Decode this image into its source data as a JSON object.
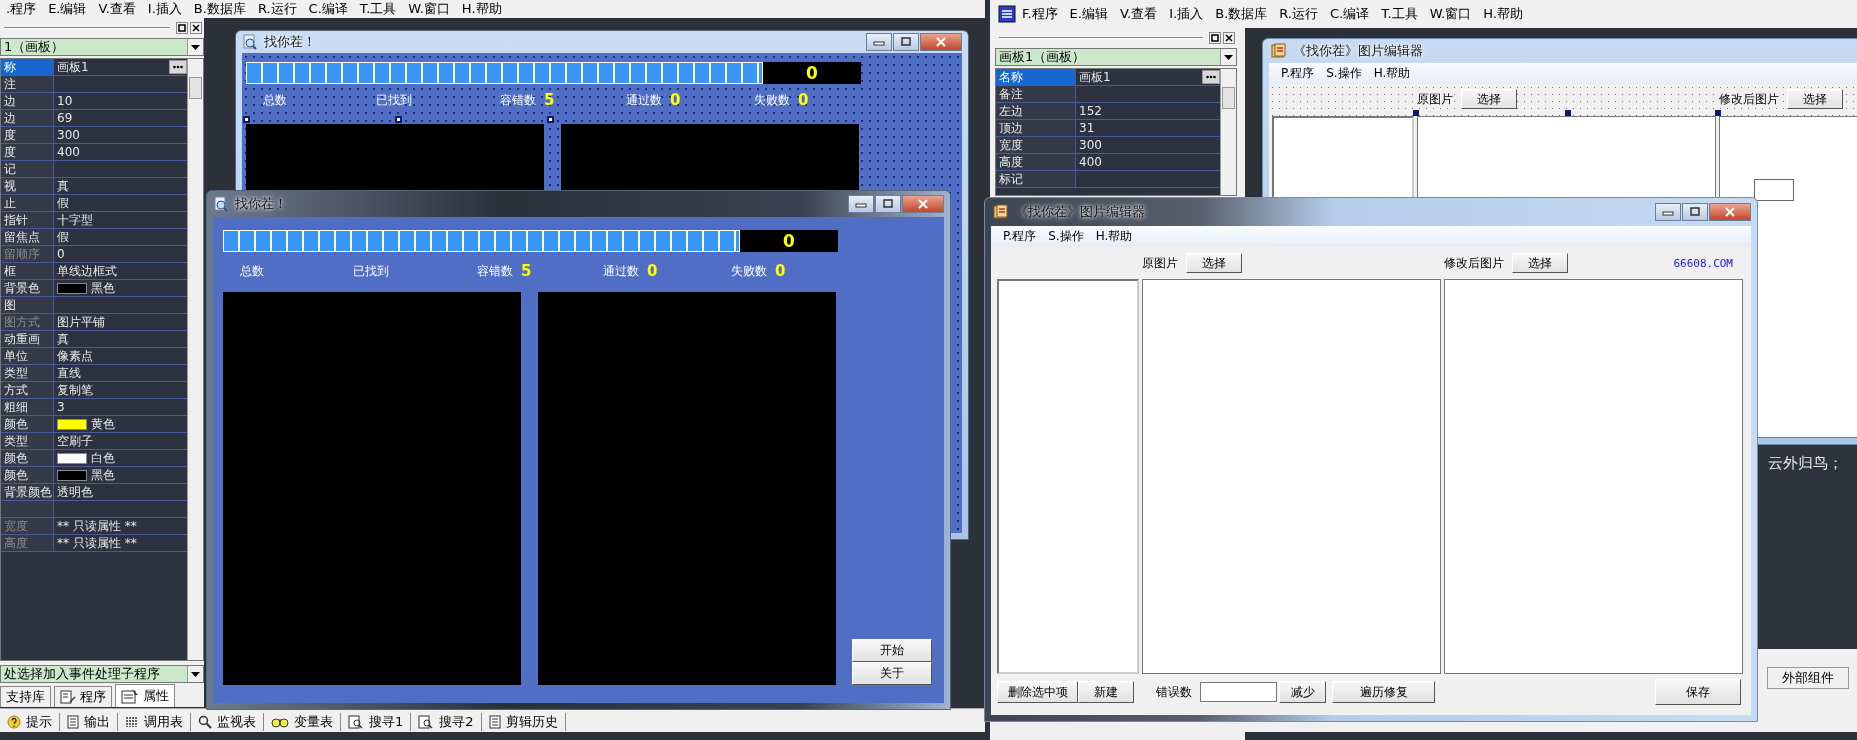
{
  "left_ide": {
    "menu": [
      ".程序",
      "E.编辑",
      "V.查看",
      "I.插入",
      "B.数据库",
      "R.运行",
      "C.编译",
      "T.工具",
      "W.窗口",
      "H.帮助"
    ],
    "property_panel": {
      "object_combo": "1（画板）",
      "rows": [
        {
          "name": "称",
          "value": "画板1",
          "kind": "text",
          "selected": true,
          "disabled": false
        },
        {
          "name": "注",
          "kind": "text",
          "selected": false,
          "disabled": false
        },
        {
          "name": "边",
          "value": "10",
          "kind": "text",
          "selected": false,
          "disabled": false
        },
        {
          "name": "边",
          "value": "69",
          "kind": "text",
          "selected": false,
          "disabled": false
        },
        {
          "name": "度",
          "value": "300",
          "kind": "text",
          "selected": false,
          "disabled": false
        },
        {
          "name": "度",
          "value": "400",
          "kind": "text",
          "selected": false,
          "disabled": false
        },
        {
          "name": "记",
          "kind": "text",
          "selected": false,
          "disabled": false
        },
        {
          "name": "视",
          "value": "真",
          "kind": "text",
          "selected": false,
          "disabled": false
        },
        {
          "name": "止",
          "value": "假",
          "kind": "text",
          "selected": false,
          "disabled": false
        },
        {
          "name": "指针",
          "value": "十字型",
          "kind": "text",
          "selected": false,
          "disabled": false
        },
        {
          "name": "留焦点",
          "value": "假",
          "kind": "text",
          "selected": false,
          "disabled": false
        },
        {
          "name": "留顺序",
          "value": "0",
          "kind": "text",
          "selected": false,
          "disabled": true
        },
        {
          "name": "框",
          "value": "单线边框式",
          "kind": "text",
          "selected": false,
          "disabled": false
        },
        {
          "name": "背景色",
          "value": "黑色",
          "kind": "color",
          "color": "#000000",
          "selected": false,
          "disabled": false
        },
        {
          "name": "图",
          "kind": "text",
          "selected": false,
          "disabled": false
        },
        {
          "name": "图方式",
          "value": "图片平铺",
          "kind": "text",
          "selected": false,
          "disabled": true
        },
        {
          "name": "动重画",
          "value": "真",
          "kind": "text",
          "selected": false,
          "disabled": false
        },
        {
          "name": "单位",
          "value": "像素点",
          "kind": "text",
          "selected": false,
          "disabled": false
        },
        {
          "name": "类型",
          "value": "直线",
          "kind": "text",
          "selected": false,
          "disabled": false
        },
        {
          "name": "方式",
          "value": "复制笔",
          "kind": "text",
          "selected": false,
          "disabled": false
        },
        {
          "name": "粗细",
          "value": "3",
          "kind": "text",
          "selected": false,
          "disabled": false
        },
        {
          "name": "颜色",
          "value": "黄色",
          "kind": "color",
          "color": "#ffff00",
          "selected": false,
          "disabled": false
        },
        {
          "name": "类型",
          "value": "空刷子",
          "kind": "text",
          "selected": false,
          "disabled": false
        },
        {
          "name": "颜色",
          "value": "白色",
          "kind": "color",
          "color": "#ffffff",
          "selected": false,
          "disabled": false
        },
        {
          "name": "颜色",
          "value": "黑色",
          "kind": "color",
          "color": "#000000",
          "selected": false,
          "disabled": false
        },
        {
          "name": "背景颜色",
          "value": "透明色",
          "kind": "text",
          "selected": false,
          "disabled": false
        },
        {
          "kind": "text",
          "selected": false
        },
        {
          "name": "宽度",
          "value": "** 只读属性 **",
          "kind": "text",
          "selected": false,
          "disabled": true
        },
        {
          "name": "高度",
          "value": "** 只读属性 **",
          "kind": "text",
          "selected": false,
          "disabled": true
        }
      ],
      "event_combo": "处选择加入事件处理子程序",
      "tabs": [
        {
          "label": "支持库",
          "selected": false
        },
        {
          "label": "程序",
          "selected": false
        },
        {
          "label": "属性",
          "selected": true
        }
      ]
    },
    "bottom_tabs": [
      "提示",
      "输出",
      "调用表",
      "监视表",
      "变量表",
      "搜寻1",
      "搜寻2",
      "剪辑历史"
    ]
  },
  "designer_window": {
    "title": "找你茬！",
    "counter": "0",
    "timer": {
      "level": 1
    },
    "stats": [
      {
        "label": "总数"
      },
      {
        "label": "已找到"
      },
      {
        "label": "容错数",
        "value": "5"
      },
      {
        "label": "通过数",
        "value": "0"
      },
      {
        "label": "失败数",
        "value": "0"
      }
    ]
  },
  "game_window": {
    "title": "找你茬！",
    "counter": "0",
    "timer": {
      "level": 1
    },
    "stats": [
      {
        "label": "总数"
      },
      {
        "label": "已找到"
      },
      {
        "label": "容错数",
        "value": "5"
      },
      {
        "label": "通过数",
        "value": "0"
      },
      {
        "label": "失败数",
        "value": "0"
      }
    ],
    "buttons": [
      "开始",
      "关于"
    ]
  },
  "right_ide": {
    "menu": [
      "F.程序",
      "E.编辑",
      "V.查看",
      "I.插入",
      "B.数据库",
      "R.运行",
      "C.编译",
      "T.工具",
      "W.窗口",
      "H.帮助"
    ],
    "property_panel": {
      "object_combo": "画板1（画板）",
      "rows": [
        {
          "name": "名称",
          "value": "画板1",
          "kind": "text",
          "selected": true,
          "disabled": false
        },
        {
          "name": "备注",
          "kind": "text",
          "selected": false,
          "disabled": false
        },
        {
          "name": "左边",
          "value": "152",
          "kind": "text",
          "selected": false,
          "disabled": false
        },
        {
          "name": "顶边",
          "value": "31",
          "kind": "text",
          "selected": false,
          "disabled": false
        },
        {
          "name": "宽度",
          "value": "300",
          "kind": "text",
          "selected": false,
          "disabled": false
        },
        {
          "name": "高度",
          "value": "400",
          "kind": "text",
          "selected": false,
          "disabled": false
        },
        {
          "name": "标记",
          "kind": "text",
          "selected": false,
          "disabled": false
        }
      ]
    },
    "text_panel": "云外归鸟；",
    "dock_tab": "外部组件"
  },
  "editor_designer": {
    "title": "《找你茬》图片编辑器",
    "menu": [
      "P.程序",
      "S.操作",
      "H.帮助"
    ],
    "original": {
      "label": "原图片",
      "button": "选择"
    },
    "modified": {
      "label": "修改后图片",
      "button": "选择"
    }
  },
  "editor_window": {
    "title": "《找你茬》图片编辑器",
    "menu": [
      "P.程序",
      "S.操作",
      "H.帮助"
    ],
    "original": {
      "label": "原图片",
      "button": "选择"
    },
    "modified": {
      "label": "修改后图片",
      "button": "选择"
    },
    "site_link": "66608.COM",
    "bottom": {
      "delete_button": "删除选中项",
      "new_button": "新建",
      "error_label": "错误数",
      "reduce_button": "减少",
      "repair_button": "遍历修复",
      "save_button": "保存"
    }
  }
}
